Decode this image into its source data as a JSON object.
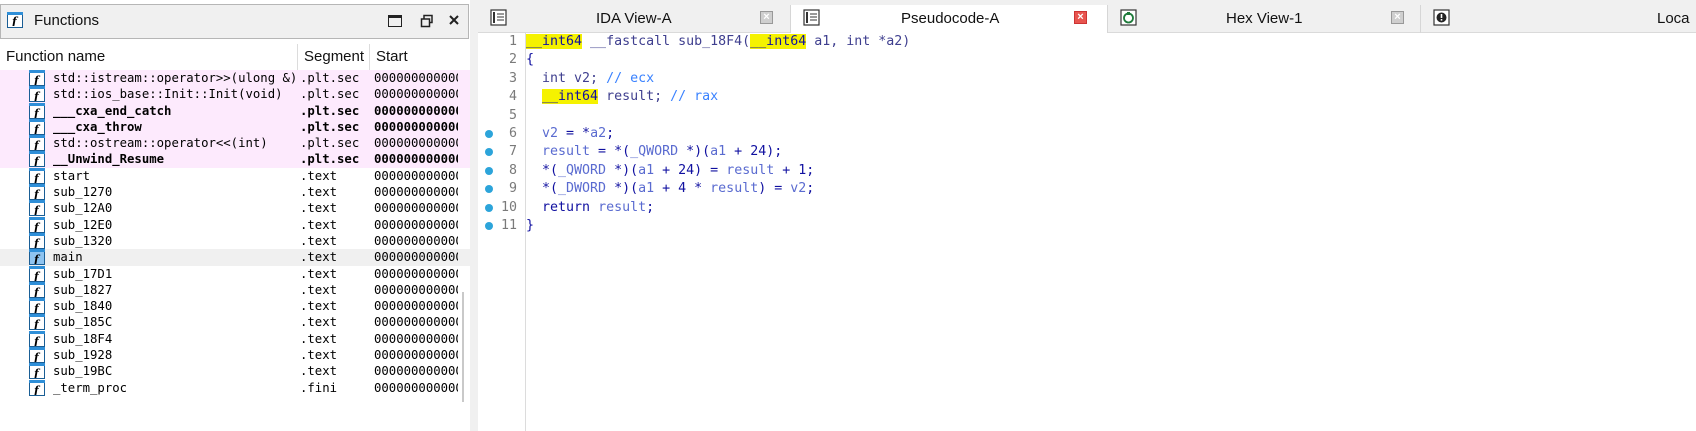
{
  "functions_panel": {
    "title": "Functions",
    "columns": {
      "name": "Function name",
      "segment": "Segment",
      "start": "Start"
    },
    "rows": [
      {
        "name": "std::istream::operator>>(ulong &)",
        "segment": ".plt.sec",
        "start": "000000000000",
        "style": "pink"
      },
      {
        "name": "std::ios_base::Init::Init(void)",
        "segment": ".plt.sec",
        "start": "000000000000",
        "style": "pink"
      },
      {
        "name": "___cxa_end_catch",
        "segment": ".plt.sec",
        "start": "000000000000",
        "style": "pink-bold"
      },
      {
        "name": "___cxa_throw",
        "segment": ".plt.sec",
        "start": "000000000000",
        "style": "pink-bold"
      },
      {
        "name": "std::ostream::operator<<(int)",
        "segment": ".plt.sec",
        "start": "000000000000",
        "style": "pink"
      },
      {
        "name": "__Unwind_Resume",
        "segment": ".plt.sec",
        "start": "000000000000",
        "style": "pink-bold"
      },
      {
        "name": "start",
        "segment": ".text",
        "start": "000000000000",
        "style": "normal"
      },
      {
        "name": "sub_1270",
        "segment": ".text",
        "start": "000000000000",
        "style": "normal"
      },
      {
        "name": "sub_12A0",
        "segment": ".text",
        "start": "000000000000",
        "style": "normal"
      },
      {
        "name": "sub_12E0",
        "segment": ".text",
        "start": "000000000000",
        "style": "normal"
      },
      {
        "name": "sub_1320",
        "segment": ".text",
        "start": "000000000000",
        "style": "normal"
      },
      {
        "name": "main",
        "segment": ".text",
        "start": "000000000000",
        "style": "selected"
      },
      {
        "name": "sub_17D1",
        "segment": ".text",
        "start": "000000000000",
        "style": "normal"
      },
      {
        "name": "sub_1827",
        "segment": ".text",
        "start": "000000000000",
        "style": "normal"
      },
      {
        "name": "sub_1840",
        "segment": ".text",
        "start": "000000000000",
        "style": "normal"
      },
      {
        "name": "sub_185C",
        "segment": ".text",
        "start": "000000000000",
        "style": "normal"
      },
      {
        "name": "sub_18F4",
        "segment": ".text",
        "start": "000000000000",
        "style": "normal"
      },
      {
        "name": "sub_1928",
        "segment": ".text",
        "start": "000000000000",
        "style": "normal"
      },
      {
        "name": "sub_19BC",
        "segment": ".text",
        "start": "000000000000",
        "style": "normal"
      },
      {
        "name": "_term_proc",
        "segment": ".fini",
        "start": "000000000000",
        "style": "normal"
      }
    ]
  },
  "tabs": [
    {
      "label": "IDA View-A",
      "icon": "ida-view-icon",
      "active": false
    },
    {
      "label": "Pseudocode-A",
      "icon": "pseudocode-icon",
      "active": true
    },
    {
      "label": "Hex View-1",
      "icon": "hex-view-icon",
      "active": false
    },
    {
      "label": "Loca",
      "icon": "locals-icon",
      "active": false
    }
  ],
  "code": {
    "lines": [
      {
        "n": "1",
        "bp": false,
        "tokens": [
          [
            "hl",
            "__int64"
          ],
          [
            "gray",
            " __fastcall sub_18F4("
          ],
          [
            "hl",
            "__int64"
          ],
          [
            "gray",
            " a1, int *a2)"
          ]
        ]
      },
      {
        "n": "2",
        "bp": false,
        "tokens": [
          [
            "kw",
            "{"
          ]
        ]
      },
      {
        "n": "3",
        "bp": false,
        "tokens": [
          [
            "gray",
            "  int v2; "
          ],
          [
            "cmt",
            "// ecx"
          ]
        ]
      },
      {
        "n": "4",
        "bp": false,
        "tokens": [
          [
            "kw",
            "  "
          ],
          [
            "hl",
            "__int64"
          ],
          [
            "gray",
            " result; "
          ],
          [
            "cmt",
            "// rax"
          ]
        ]
      },
      {
        "n": "5",
        "bp": false,
        "tokens": []
      },
      {
        "n": "6",
        "bp": true,
        "tokens": [
          [
            "tv",
            "  v2"
          ],
          [
            "kw",
            " = *"
          ],
          [
            "tv",
            "a2"
          ],
          [
            "kw",
            ";"
          ]
        ]
      },
      {
        "n": "7",
        "bp": true,
        "tokens": [
          [
            "tv",
            "  result"
          ],
          [
            "kw",
            " = *("
          ],
          [
            "tv",
            "_QWORD"
          ],
          [
            "kw",
            " *)("
          ],
          [
            "tv",
            "a1"
          ],
          [
            "kw",
            " + 24);"
          ]
        ]
      },
      {
        "n": "8",
        "bp": true,
        "tokens": [
          [
            "kw",
            "  *("
          ],
          [
            "tv",
            "_QWORD"
          ],
          [
            "kw",
            " *)("
          ],
          [
            "tv",
            "a1"
          ],
          [
            "kw",
            " + 24) = "
          ],
          [
            "tv",
            "result"
          ],
          [
            "kw",
            " + 1;"
          ]
        ]
      },
      {
        "n": "9",
        "bp": true,
        "tokens": [
          [
            "kw",
            "  *("
          ],
          [
            "tv",
            "_DWORD"
          ],
          [
            "kw",
            " *)("
          ],
          [
            "tv",
            "a1"
          ],
          [
            "kw",
            " + 4 * "
          ],
          [
            "tv",
            "result"
          ],
          [
            "kw",
            ") = "
          ],
          [
            "tv",
            "v2"
          ],
          [
            "kw",
            ";"
          ]
        ]
      },
      {
        "n": "10",
        "bp": true,
        "tokens": [
          [
            "kw",
            "  return "
          ],
          [
            "tv",
            "result"
          ],
          [
            "kw",
            ";"
          ]
        ]
      },
      {
        "n": "11",
        "bp": true,
        "tokens": [
          [
            "kw",
            "}"
          ]
        ]
      }
    ]
  }
}
